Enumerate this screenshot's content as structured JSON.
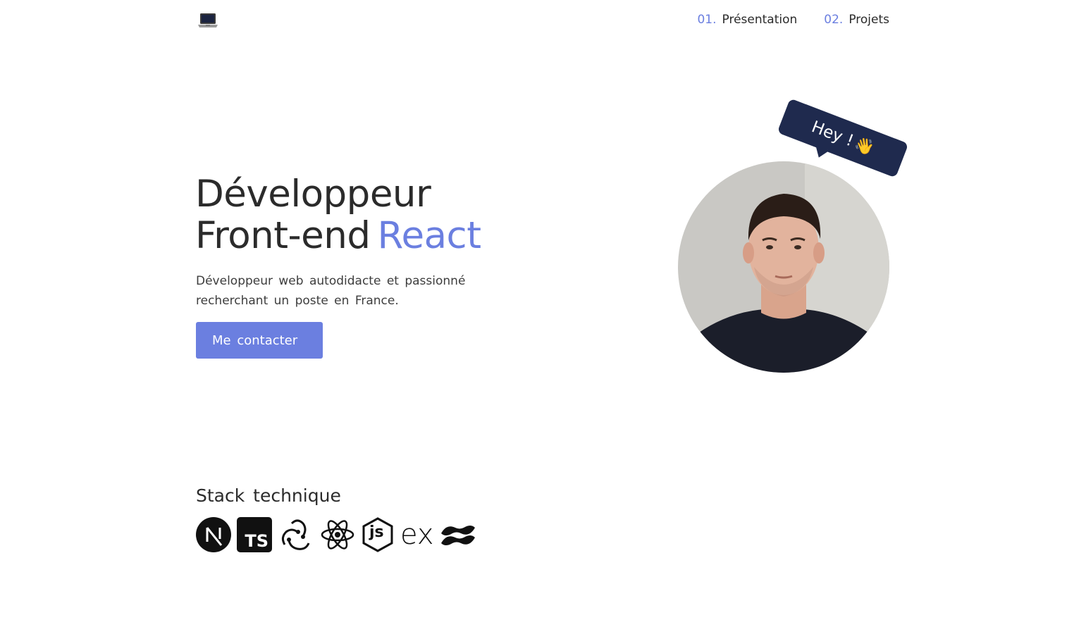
{
  "header": {
    "logo_icon": "laptop-icon",
    "nav": [
      {
        "num": "01.",
        "label": "Présentation"
      },
      {
        "num": "02.",
        "label": "Projets"
      }
    ]
  },
  "hero": {
    "title_line1": "Développeur",
    "title_line2": "Front-end",
    "title_accent": "React",
    "description": "Développeur web autodidacte et passionné recherchant un poste en France.",
    "cta_label": "Me contacter",
    "bubble_text": "Hey !",
    "bubble_emoji": "👋"
  },
  "stack": {
    "title": "Stack technique",
    "icons": [
      "nextjs-icon",
      "typescript-icon",
      "redux-icon",
      "react-icon",
      "nodejs-icon",
      "express-icon",
      "tailwind-icon"
    ],
    "ts_text": "TS",
    "js_text": "js",
    "ex_text": "ex"
  },
  "colors": {
    "accent": "#6b7fe0",
    "bubble": "#1f2a4e",
    "text": "#2b2b2b"
  }
}
